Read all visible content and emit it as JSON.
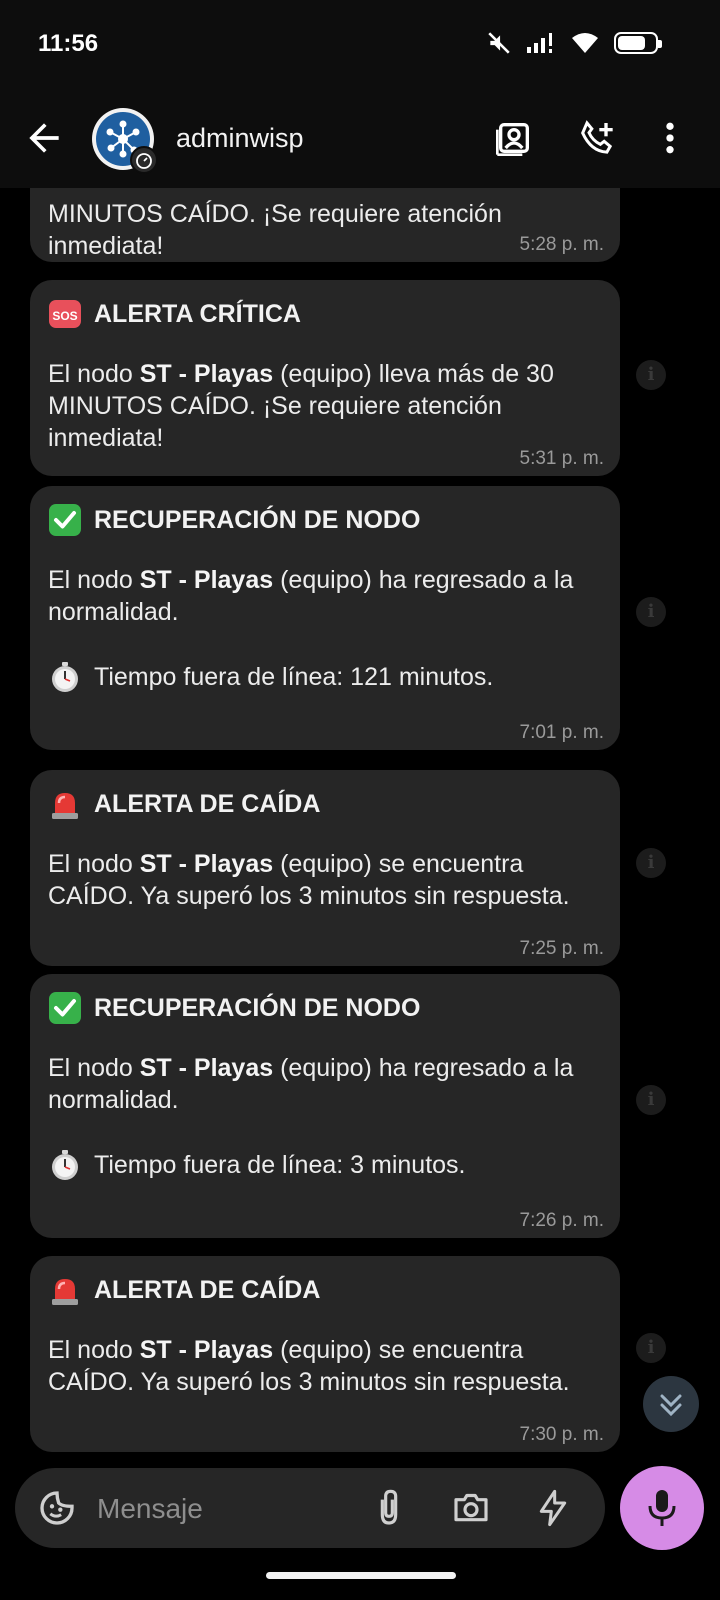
{
  "status_bar": {
    "time": "11:56",
    "battery_level": 0.75
  },
  "header": {
    "title": "adminwisp",
    "back_icon": "arrow-left-icon",
    "icons": [
      "contact-card-icon",
      "add-call-icon",
      "more-vert-icon"
    ]
  },
  "chat": {
    "partial_message": {
      "text": "MINUTOS CAÍDO. ¡Se requiere atención inmediata!",
      "time": "5:28 p. m."
    },
    "messages": [
      {
        "icon": "sos-icon",
        "title": "ALERTA CRÍTICA",
        "body_pre": "El nodo ",
        "body_bold": "ST - Playas",
        "body_post": " (equipo) lleva más de 30 MINUTOS CAÍDO. ¡Se requiere atención inmediata!",
        "extra": "",
        "time": "5:31 p. m."
      },
      {
        "icon": "check-icon",
        "title": "RECUPERACIÓN DE NODO",
        "body_pre": "El nodo ",
        "body_bold": "ST - Playas",
        "body_post": " (equipo) ha regresado a la normalidad.",
        "extra": "Tiempo fuera de línea: 121 minutos.",
        "time": "7:01 p. m."
      },
      {
        "icon": "siren-icon",
        "title": "ALERTA DE CAÍDA",
        "body_pre": "El nodo ",
        "body_bold": "ST - Playas",
        "body_post": " (equipo) se encuentra CAÍDO. Ya superó los 3 minutos sin respuesta.",
        "extra": "",
        "time": "7:25 p. m."
      },
      {
        "icon": "check-icon",
        "title": "RECUPERACIÓN DE NODO",
        "body_pre": "El nodo ",
        "body_bold": "ST - Playas",
        "body_post": " (equipo) ha regresado a la normalidad.",
        "extra": "Tiempo fuera de línea: 3 minutos.",
        "time": "7:26 p. m."
      },
      {
        "icon": "siren-icon",
        "title": "ALERTA DE CAÍDA",
        "body_pre": "El nodo ",
        "body_bold": "ST - Playas",
        "body_post": " (equipo) se encuentra CAÍDO. Ya superó los 3 minutos sin respuesta.",
        "extra": "",
        "time": "7:30 p. m."
      }
    ]
  },
  "input_bar": {
    "placeholder": "Mensaje"
  },
  "colors": {
    "bubble": "#262626",
    "accent_mic": "#d68be6",
    "background": "#000000"
  }
}
